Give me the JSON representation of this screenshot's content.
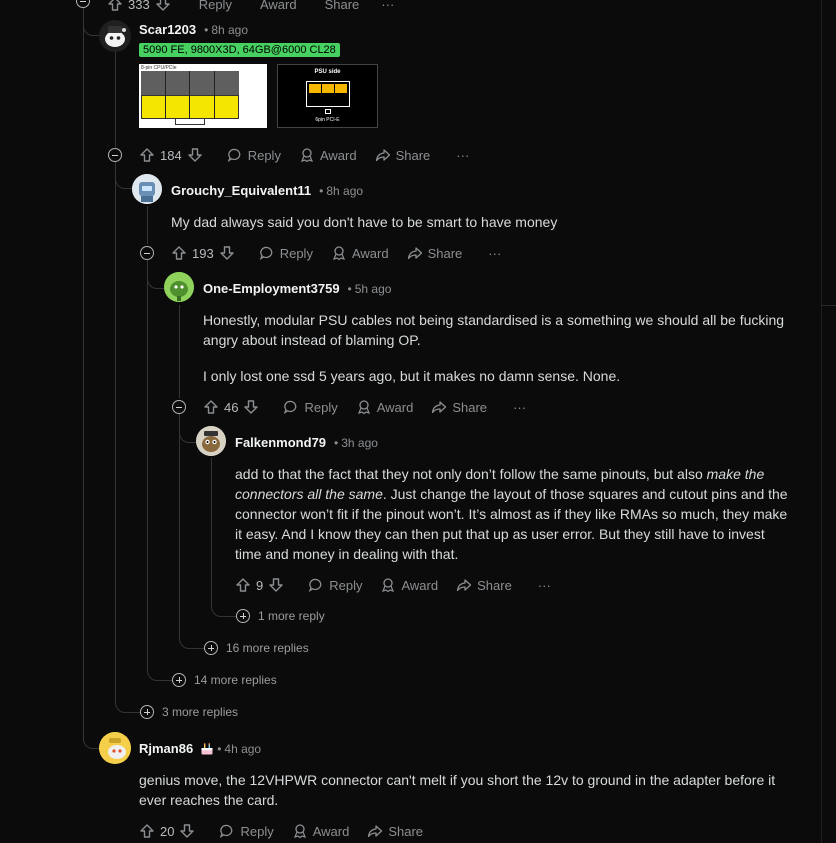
{
  "top_actions": {
    "votes": "333",
    "reply": "Reply",
    "award": "Award",
    "share": "Share",
    "more": "···"
  },
  "comments": [
    {
      "author": "Scar1203",
      "time": "8h ago",
      "flair": "5090 FE, 9800X3D, 64GB@6000 CL28",
      "images": [
        {
          "caption": "8-pin CPU/PCIe"
        },
        {
          "title": "PSU side",
          "caption": "6pin PCI-E"
        }
      ],
      "votes": "184"
    },
    {
      "author": "Grouchy_Equivalent11",
      "time": "8h ago",
      "body": "My dad always said you don't have to be smart to have money",
      "votes": "193"
    },
    {
      "author": "One-Employment3759",
      "time": "5h ago",
      "body_p1": "Honestly, modular PSU cables not being standardised is a something we should all be fucking angry about instead of blaming OP.",
      "body_p2": "I only lost one ssd 5 years ago, but it makes no damn sense. None.",
      "votes": "46"
    },
    {
      "author": "Falkenmond79",
      "time": "3h ago",
      "body_a": "add to that the fact that they not only don’t follow the same pinouts, but also ",
      "body_em": "make the connectors all the same",
      "body_b": ". Just change the layout of those squares and cutout pins and the connector won’t fit if the pinout won’t. It’s almost as if they like RMAs so much, they make it easy. And I know they can then put that up as user error. But they still have to invest time and money in dealing with that.",
      "votes": "9"
    },
    {
      "author": "Rjman86",
      "time": "4h ago",
      "body": "genius move, the 12VHPWR connector can't melt if you short the 12v to ground in the adapter before it ever reaches the card.",
      "votes": "20"
    }
  ],
  "more_replies": [
    "1 more reply",
    "16 more replies",
    "14 more replies",
    "3 more replies"
  ],
  "labels": {
    "reply": "Reply",
    "award": "Award",
    "share": "Share",
    "more": "···",
    "bullet": "•"
  }
}
